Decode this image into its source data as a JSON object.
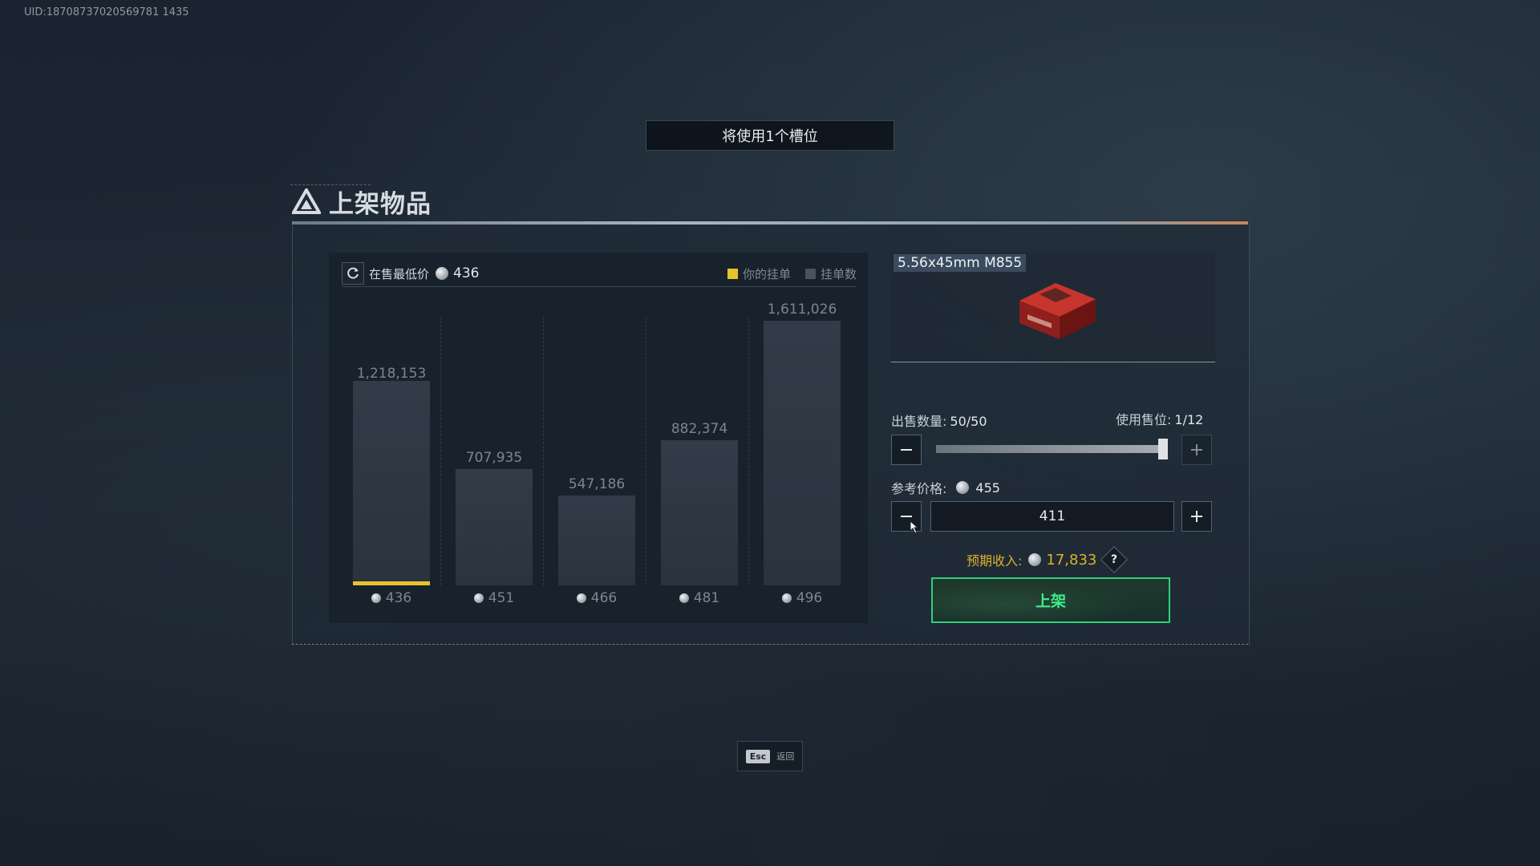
{
  "uid": "UID:18708737020569781 1435",
  "slot_notice": "将使用1个槽位",
  "panel_title": "上架物品",
  "chart_header": {
    "label": "在售最低价",
    "lowest_price": "436",
    "legend": [
      "你的挂单",
      "挂单数"
    ]
  },
  "chart_data": {
    "type": "bar",
    "categories": [
      "436",
      "451",
      "466",
      "481",
      "496"
    ],
    "values": [
      1218153,
      707935,
      547186,
      882374,
      1611026
    ],
    "value_labels": [
      "1,218,153",
      "707,935",
      "547,186",
      "882,374",
      "1,611,026"
    ],
    "highlight_index": 0,
    "legend": [
      "你的挂单",
      "挂单数"
    ],
    "colors": {
      "bar": "#2e3843",
      "mine": "#e7c22f",
      "listing_count": "#4a525b"
    }
  },
  "item": {
    "name": "5.56x45mm M855"
  },
  "sell_quantity": {
    "label": "出售数量:",
    "value": "50/50",
    "fraction": 1.0
  },
  "slots_used": {
    "label": "使用售位:",
    "value": "1/12"
  },
  "reference_price": {
    "label": "参考价格:",
    "value": "455"
  },
  "price_input": {
    "value": "411"
  },
  "expected_income": {
    "label": "预期收入:",
    "value": "17,833"
  },
  "list_button": "上架",
  "esc_hint": {
    "key": "Esc",
    "label": "返回"
  },
  "colors": {
    "accent_green": "#2fd07a",
    "accent_gold": "#dcb22a"
  },
  "icons": [
    "refresh-icon",
    "coin-icon",
    "minus-icon",
    "plus-icon",
    "help-icon",
    "triangle-logo-icon",
    "ammo-box-icon"
  ]
}
